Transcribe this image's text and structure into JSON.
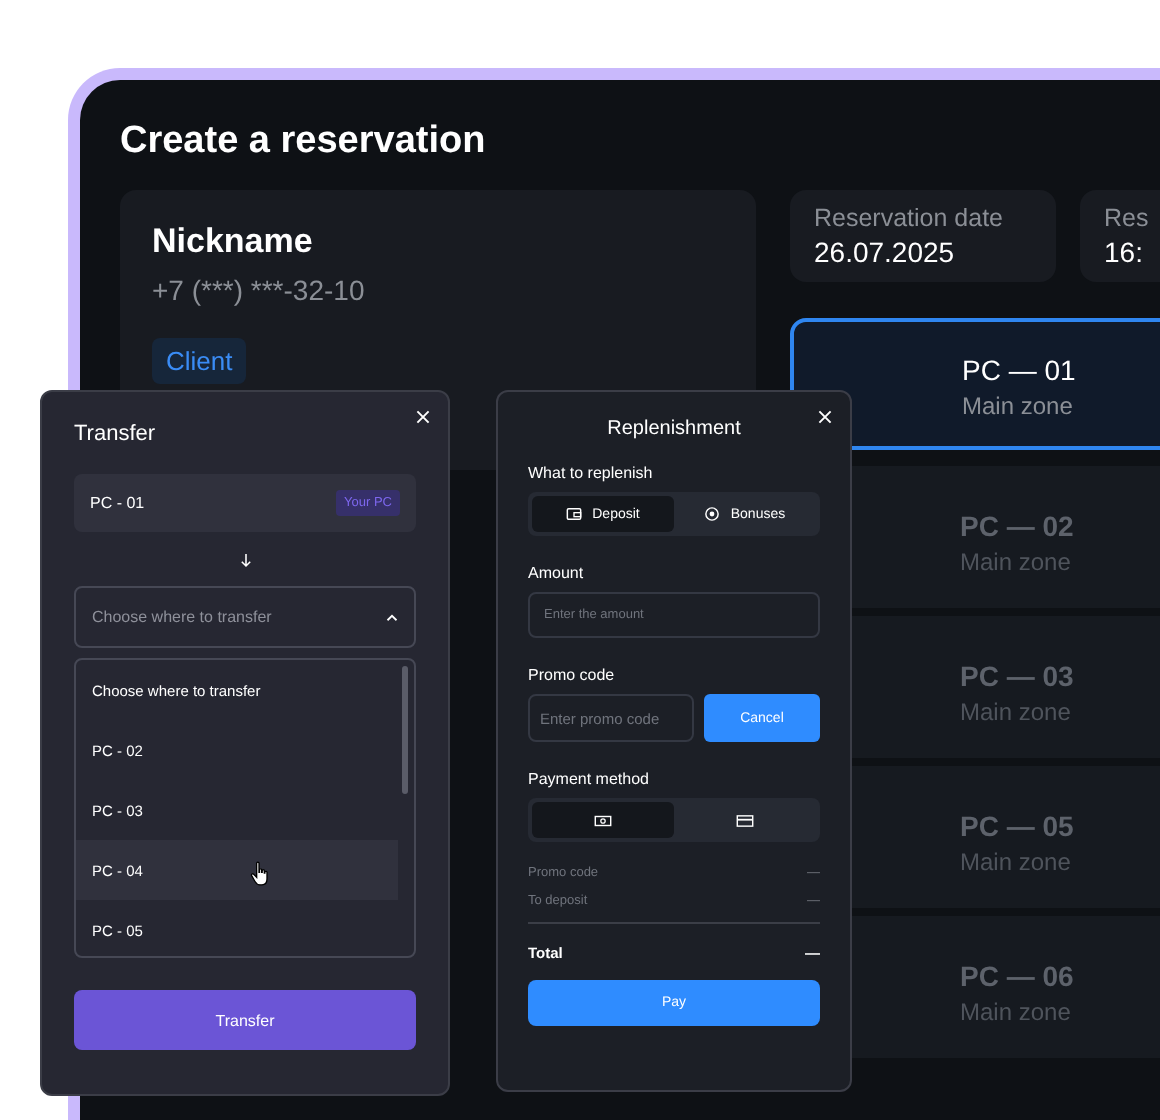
{
  "page": {
    "title": "Create a reservation"
  },
  "client": {
    "name": "Nickname",
    "phone": "+7 (***) ***-32-10",
    "tag": "Client"
  },
  "info_cards": [
    {
      "label": "Reservation date",
      "value": "26.07.2025"
    },
    {
      "label": "Res",
      "value": "16:"
    }
  ],
  "pcs": [
    {
      "name": "PC — 01",
      "zone": "Main zone",
      "selected": true
    },
    {
      "name": "PC — 02",
      "zone": "Main zone",
      "selected": false
    },
    {
      "name": "PC — 03",
      "zone": "Main zone",
      "selected": false
    },
    {
      "name": "PC — 05",
      "zone": "Main zone",
      "selected": false
    },
    {
      "name": "PC — 06",
      "zone": "Main zone",
      "selected": false
    }
  ],
  "transfer_dialog": {
    "title": "Transfer",
    "current": {
      "name": "PC - 01",
      "badge": "Your PC"
    },
    "select": {
      "placeholder": "Choose where to transfer",
      "expanded": true
    },
    "options": [
      {
        "label": "Choose where to transfer",
        "selected": false
      },
      {
        "label": "PC - 02",
        "selected": false
      },
      {
        "label": "PC - 03",
        "selected": false
      },
      {
        "label": "PC - 04",
        "selected": true
      },
      {
        "label": "PC - 05",
        "selected": false
      }
    ],
    "button": "Transfer"
  },
  "replenish_dialog": {
    "title": "Replenishment",
    "what_label": "What to replenish",
    "targets": [
      {
        "kind": "wallet",
        "label": "Deposit",
        "selected": true
      },
      {
        "kind": "bonus",
        "label": "Bonuses",
        "selected": false
      }
    ],
    "amount": {
      "label": "Amount",
      "placeholder": "Enter the amount"
    },
    "promo": {
      "label": "Promo code",
      "placeholder": "Enter promo code",
      "button": "Cancel"
    },
    "payment_label": "Payment method",
    "payment_methods": [
      {
        "kind": "cash",
        "selected": true
      },
      {
        "kind": "card",
        "selected": false
      }
    ],
    "summary": [
      {
        "label": "Promo code",
        "value": "—"
      },
      {
        "label": "To deposit",
        "value": "—"
      }
    ],
    "total": {
      "label": "Total",
      "value": "—"
    },
    "button": "Pay"
  }
}
